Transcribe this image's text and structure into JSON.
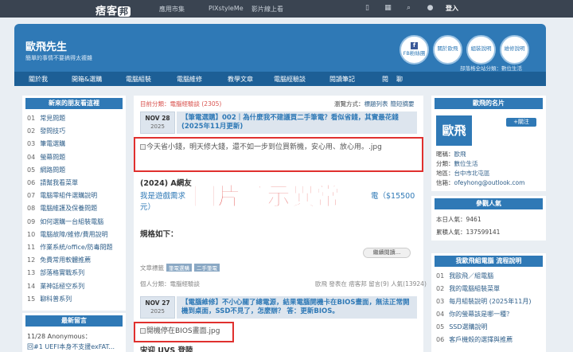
{
  "topbar": {
    "logo": "痞客",
    "logo_badge": "邦",
    "nav": [
      "應用市集",
      "PIXstyleMe",
      "影片線上看"
    ],
    "login": "登入"
  },
  "header": {
    "title": "歐飛先生",
    "subtitle": "簡單的事情不要搞得太複雜",
    "buttons": [
      "FB粉絲團",
      "關於歐飛",
      "組裝說明",
      "維修說明"
    ],
    "category": "部落格全站分類：數位生活"
  },
  "menu": [
    "關於我",
    "開箱&選購",
    "電腦組裝",
    "電腦維修",
    "教學文章",
    "電腦經驗談",
    "閱讀筆記",
    "閱",
    "聊"
  ],
  "left": {
    "head1": "新來的朋友看這裡",
    "items": [
      {
        "n": "01",
        "t": "常見問題"
      },
      {
        "n": "02",
        "t": "發問技巧"
      },
      {
        "n": "03",
        "t": "筆電選購"
      },
      {
        "n": "04",
        "t": "螢幕問題"
      },
      {
        "n": "05",
        "t": "網路問題"
      },
      {
        "n": "06",
        "t": "請幫我看菜單"
      },
      {
        "n": "07",
        "t": "電腦零組件選購說明"
      },
      {
        "n": "08",
        "t": "電腦維護及保養問題"
      },
      {
        "n": "09",
        "t": "如何選購一台組裝電腦"
      },
      {
        "n": "10",
        "t": "電腦故障/維修/費用說明"
      },
      {
        "n": "11",
        "t": "作業系統/office/防毒問題"
      },
      {
        "n": "12",
        "t": "免費常用軟體推薦"
      },
      {
        "n": "13",
        "t": "部落格實戰系列"
      },
      {
        "n": "14",
        "t": "業神話極空系列"
      },
      {
        "n": "15",
        "t": "聊科普系列"
      }
    ],
    "head2": "最新留言",
    "comment_line1": "11/28 Anonymous：",
    "comment_line2": "回#1 UEFI本身不支援exFAT..."
  },
  "main": {
    "category_prefix": "目前分類：",
    "category": "電腦經驗談 (2305)",
    "view_mode_prefix": "瀏覽方式：",
    "view_list": "標題列表",
    "view_summary": "簡短摘要",
    "post1": {
      "date": "NOV 28",
      "year": "2025",
      "title": "【筆電選購】002｜為什麼我不建議買二手筆電？看似省錢，其實最花錢 (2025年11月更新)",
      "broken_alt": "今天省小錢，明天修大錢，還不如一步到位買新機，安心用、放心用。.jpg",
      "blue_heading": "(2024) A網友",
      "blue_text_1": "我是遊戲需求",
      "blue_text_2": "電（$15500",
      "blue_text_3": "元）",
      "spec": "規格如下：",
      "readmore": "繼續閱讀...",
      "tags_label": "文章標籤",
      "tags": [
        "筆電選購",
        "二手筆電"
      ],
      "author_label": "個人分類：電腦經驗談",
      "stats": "歐飛 發表在 痞客邦 留言(9) 人氣(13924)"
    },
    "post2": {
      "date": "NOV 27",
      "year": "2025",
      "title": "【電腦維修】不小心關了總電源，結果電腦開機卡在BIOS畫面，無法正常開機到桌面，SSD不見了，怎麼辦？ 答：更新BIOS。",
      "broken_alt": "開機停在BIOS畫面.jpg",
      "next_line": "宋迎 UVS 登陸"
    },
    "annotation": "圖片顯示異常"
  },
  "right": {
    "head1": "歐飛的名片",
    "avatar": "歐飛",
    "add": "+關注",
    "lines": [
      {
        "label": "暱稱：",
        "value": "歐飛"
      },
      {
        "label": "分類：",
        "value": "數位生活"
      },
      {
        "label": "地區：",
        "value": "台中市北屯區"
      },
      {
        "label": "信箱：",
        "value": "ofeyhong@outlook.com"
      }
    ],
    "head2": "參觀人氣",
    "today": "本日人氣：9461",
    "total": "累積人氣：137599141",
    "head3": "我歐飛組電腦 流程說明",
    "items": [
      {
        "n": "01",
        "t": "我歐飛／組電腦"
      },
      {
        "n": "02",
        "t": "我的電腦組裝菜單"
      },
      {
        "n": "03",
        "t": "每月組裝說明 (2025年11月)"
      },
      {
        "n": "04",
        "t": "你的螢幕該是哪一種？"
      },
      {
        "n": "05",
        "t": "SSD選購說明"
      },
      {
        "n": "06",
        "t": "客戶機殼的選擇與推薦"
      }
    ]
  }
}
